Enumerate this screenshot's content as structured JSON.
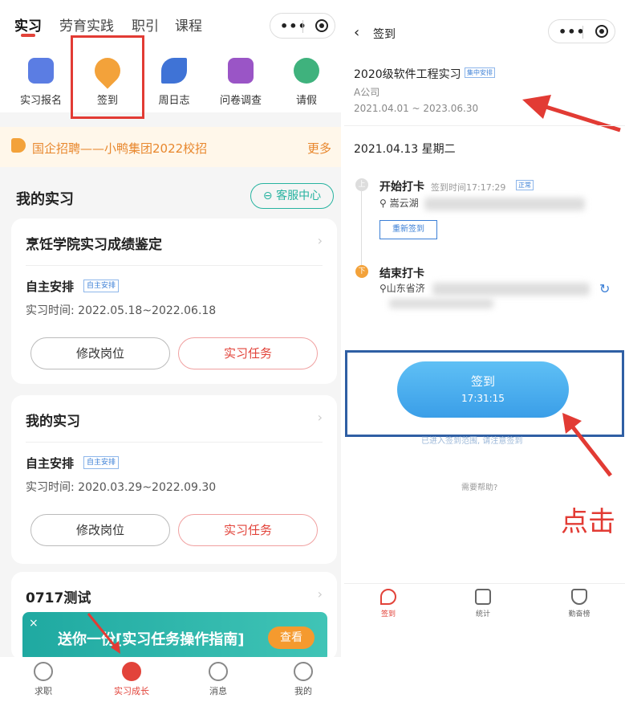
{
  "left": {
    "tabs": [
      "实习",
      "劳育实践",
      "职引",
      "课程"
    ],
    "active_tab": "实习",
    "capsule": {
      "menu_icon": "more-dots-icon",
      "close_icon": "target-icon"
    },
    "nav": [
      {
        "label": "实习报名",
        "icon": "clipboard-icon",
        "color": "#5b7de3"
      },
      {
        "label": "签到",
        "icon": "location-star-icon",
        "color": "#f3a23a"
      },
      {
        "label": "周日志",
        "icon": "pen-icon",
        "color": "#3f73d6"
      },
      {
        "label": "问卷调查",
        "icon": "survey-icon",
        "color": "#9a55c6"
      },
      {
        "label": "请假",
        "icon": "leave-icon",
        "color": "#3fb27d"
      }
    ],
    "banner": {
      "text": "国企招聘——小鸭集团2022校招",
      "more": "更多",
      "icon": "speaker-icon"
    },
    "section_title": "我的实习",
    "service_button": "客服中心",
    "cards": [
      {
        "title": "烹饪学院实习成绩鉴定",
        "type": "自主安排",
        "badge": "自主安排",
        "time": "实习时间: 2022.05.18~2022.06.18",
        "btn_left": "修改岗位",
        "btn_right": "实习任务"
      },
      {
        "title": "我的实习",
        "type": "自主安排",
        "badge": "自主安排",
        "time": "实习时间: 2020.03.29~2022.09.30",
        "btn_left": "修改岗位",
        "btn_right": "实习任务"
      }
    ],
    "card3_title": "0717测试",
    "promo": {
      "text": "送你一份[实习任务操作指南]",
      "button": "查看",
      "close": "×"
    },
    "bottom_nav": [
      {
        "label": "求职",
        "icon": "job-icon"
      },
      {
        "label": "实习成长",
        "icon": "growth-icon",
        "active": true
      },
      {
        "label": "消息",
        "icon": "message-icon"
      },
      {
        "label": "我的",
        "icon": "profile-icon"
      }
    ],
    "accent": "#e2433a"
  },
  "right": {
    "title": "签到",
    "back_icon": "back-chevron-icon",
    "capsule": {
      "menu_icon": "more-dots-icon",
      "close_icon": "target-icon"
    },
    "internship": "2020级软件工程实习",
    "badge": "集中安排",
    "company": "A公司",
    "date_range": "2021.04.01 ~ 2023.06.30",
    "day": "2021.04.13 星期二",
    "clock_in": {
      "dot": "上",
      "label": "开始打卡",
      "time": "签到时间17:17:29",
      "status": "正常",
      "address": "嵩云湖",
      "resign": "重新签到"
    },
    "clock_out": {
      "dot": "下",
      "label": "结束打卡",
      "address": "山东省济"
    },
    "sign_button": {
      "label": "签到",
      "time": "17:31:15"
    },
    "note": "已进入签到范围, 请注意签到",
    "help": "需要帮助?",
    "annotation": "点击",
    "bottom_nav": [
      {
        "label": "签到",
        "icon": "pin-icon",
        "active": true
      },
      {
        "label": "统计",
        "icon": "chart-icon"
      },
      {
        "label": "勤奋榜",
        "icon": "trophy-icon"
      }
    ],
    "accent": "#3a9ee8"
  }
}
